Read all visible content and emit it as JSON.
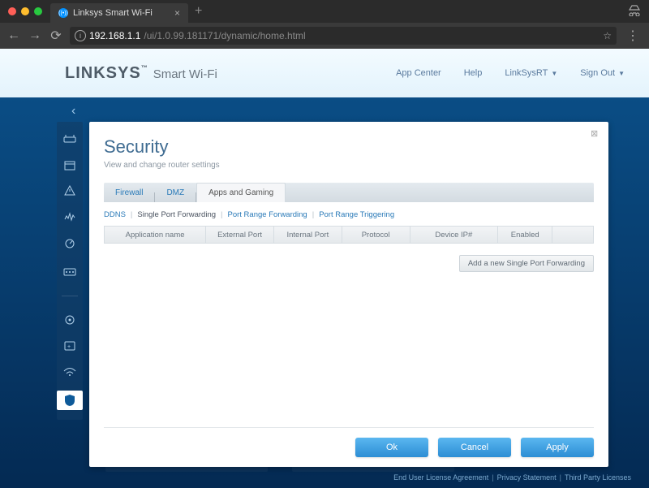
{
  "browser": {
    "tab_title": "Linksys Smart Wi-Fi",
    "url_host": "192.168.1.1",
    "url_path": "/ui/1.0.99.181171/dynamic/home.html"
  },
  "header": {
    "brand": "LINKSYS",
    "brand_sub": "Smart Wi-Fi",
    "links": {
      "app_center": "App Center",
      "help": "Help",
      "router_name": "LinkSysRT",
      "sign_out": "Sign Out"
    }
  },
  "panel": {
    "title": "Security",
    "subtitle": "View and change router settings",
    "tabs": {
      "firewall": "Firewall",
      "dmz": "DMZ",
      "apps_gaming": "Apps and Gaming"
    },
    "subtabs": {
      "ddns": "DDNS",
      "single_port": "Single Port Forwarding",
      "port_range": "Port Range Forwarding",
      "port_trigger": "Port Range Triggering"
    },
    "table": {
      "cols": {
        "app": "Application name",
        "ext": "External Port",
        "int": "Internal Port",
        "proto": "Protocol",
        "ip": "Device IP#",
        "en": "Enabled"
      }
    },
    "add_button": "Add a new Single Port Forwarding",
    "buttons": {
      "ok": "Ok",
      "cancel": "Cancel",
      "apply": "Apply"
    }
  },
  "footer": {
    "eula": "End User License Agreement",
    "privacy": "Privacy Statement",
    "third_party": "Third Party Licenses"
  }
}
